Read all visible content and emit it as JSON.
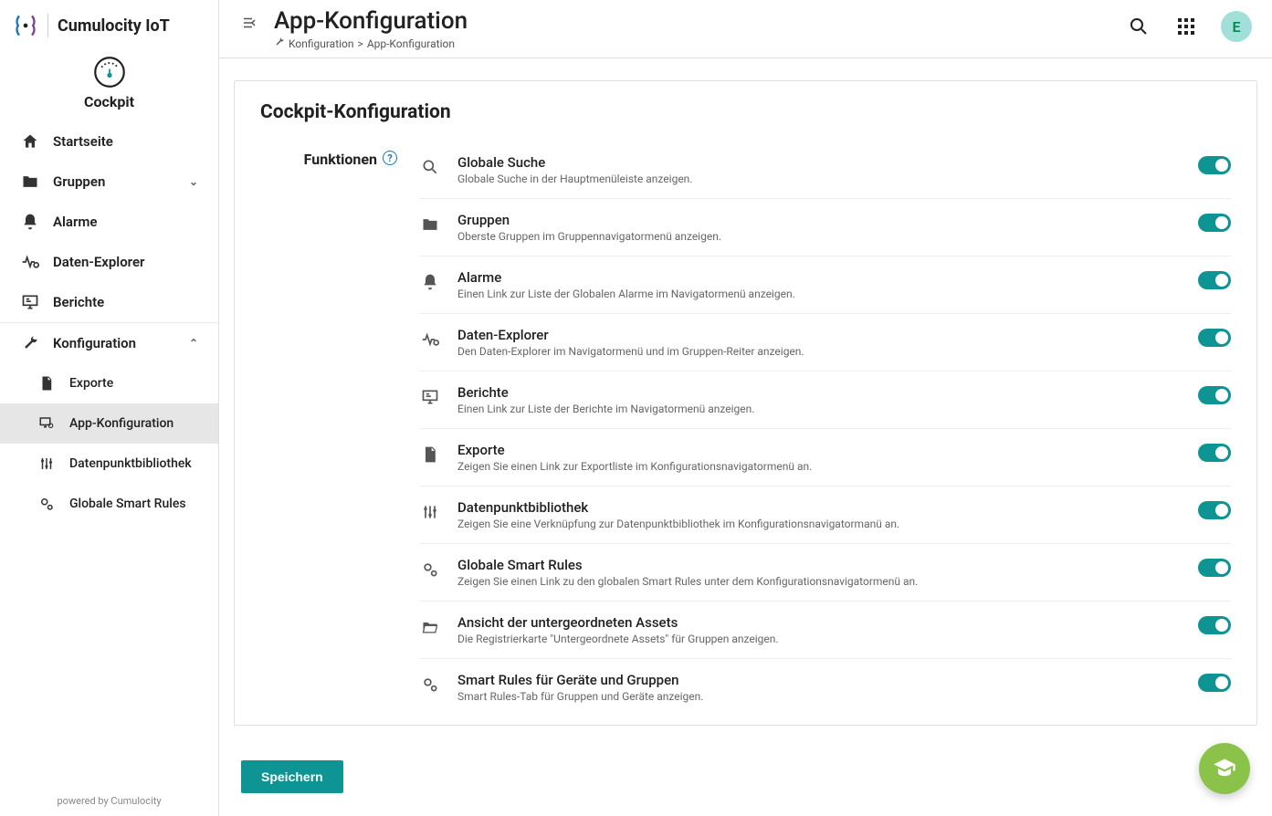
{
  "brand": {
    "name": "Cumulocity IoT"
  },
  "app": {
    "name": "Cockpit"
  },
  "sidebar_footer": "powered by Cumulocity",
  "nav": {
    "startseite": "Startseite",
    "gruppen": "Gruppen",
    "alarme": "Alarme",
    "datenExplorer": "Daten-Explorer",
    "berichte": "Berichte",
    "konfiguration": "Konfiguration",
    "sub": {
      "exporte": "Exporte",
      "appKonfig": "App-Konfiguration",
      "dpb": "Datenpunktbibliothek",
      "gsr": "Globale Smart Rules"
    }
  },
  "header": {
    "title": "App-Konfiguration",
    "crumb1": "Konfiguration",
    "crumb2": "App-Konfiguration",
    "avatar": "E"
  },
  "card": {
    "title": "Cockpit-Konfiguration",
    "sectionLabel": "Funktionen"
  },
  "features": [
    {
      "icon": "search",
      "title": "Globale Suche",
      "desc": "Globale Suche in der Hauptmenüleiste anzeigen.",
      "on": true
    },
    {
      "icon": "folder",
      "title": "Gruppen",
      "desc": "Oberste Gruppen im Gruppennavigatormenü anzeigen.",
      "on": true
    },
    {
      "icon": "bell",
      "title": "Alarme",
      "desc": "Einen Link zur Liste der Globalen Alarme im Navigatormenü anzeigen.",
      "on": true
    },
    {
      "icon": "pulse",
      "title": "Daten-Explorer",
      "desc": "Den Daten-Explorer im Navigatormenü und im Gruppen-Reiter anzeigen.",
      "on": true
    },
    {
      "icon": "board",
      "title": "Berichte",
      "desc": "Einen Link zur Liste der Berichte im Navigatormenü anzeigen.",
      "on": true
    },
    {
      "icon": "file",
      "title": "Exporte",
      "desc": "Zeigen Sie einen Link zur Exportliste im Konfigurationsnavigatormenü an.",
      "on": true
    },
    {
      "icon": "sliders",
      "title": "Datenpunktbibliothek",
      "desc": "Zeigen Sie eine Verknüpfung zur Datenpunktbibliothek im Konfigurationsnavigatormanü an.",
      "on": true
    },
    {
      "icon": "gears",
      "title": "Globale Smart Rules",
      "desc": "Zeigen Sie einen Link zu den globalen Smart Rules unter dem Konfigurationsnavigatormenü an.",
      "on": true
    },
    {
      "icon": "folder-open",
      "title": "Ansicht der untergeordneten Assets",
      "desc": "Die Registrierkarte \"Untergeordnete Assets\" für Gruppen anzeigen.",
      "on": true
    },
    {
      "icon": "gears",
      "title": "Smart Rules für Geräte und Gruppen",
      "desc": "Smart Rules-Tab für Gruppen und Geräte anzeigen.",
      "on": true
    }
  ],
  "buttons": {
    "save": "Speichern"
  }
}
